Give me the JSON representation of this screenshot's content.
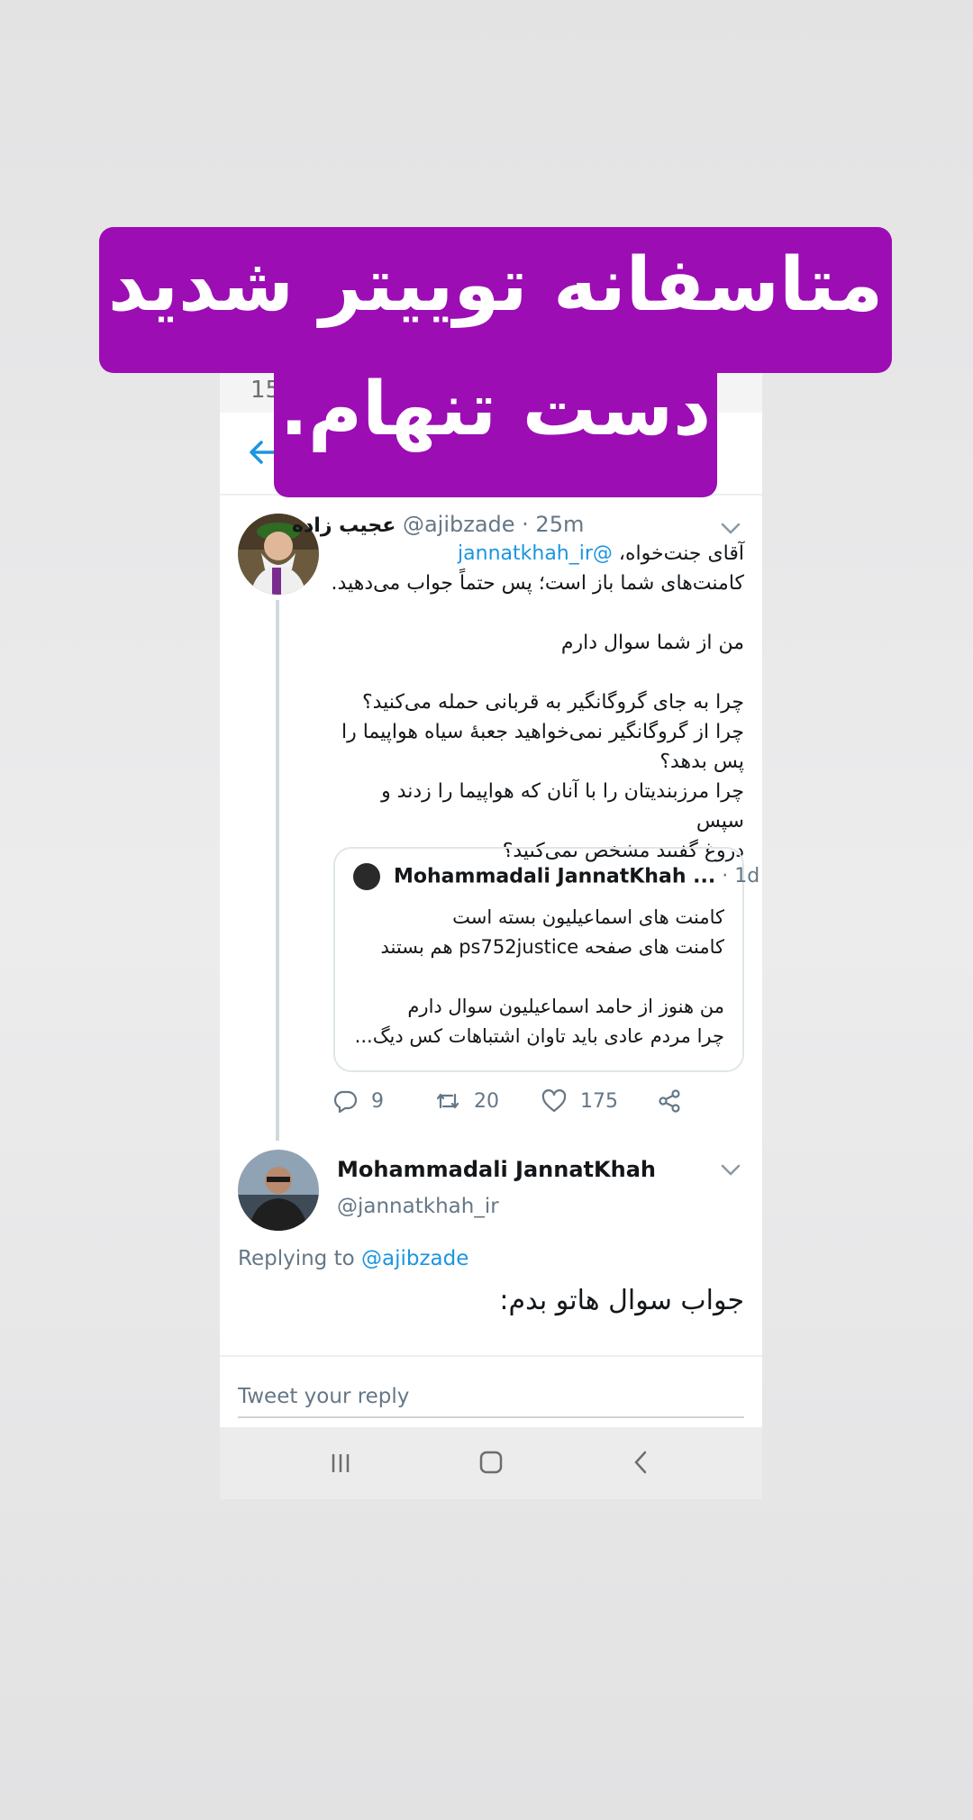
{
  "status": {
    "time_partial": "15"
  },
  "caption": {
    "line1": "متاسفانه توییتر شدید",
    "line2": "دست تنهام."
  },
  "tweet1": {
    "display_name": "عجیب زاده",
    "handle": "@ajibzade",
    "time": "· 25m",
    "lines": [
      {
        "text": "آقای جنت‌خواه، ",
        "mention": "@jannatkhah_ir"
      },
      {
        "text": "کامنت‌های شما باز است؛ پس حتماً جواب می‌دهید."
      },
      {
        "text": ""
      },
      {
        "text": "من از شما سوال دارم"
      },
      {
        "text": ""
      },
      {
        "text": "چرا به جای گروگانگیر به قربانی حمله می‌کنید؟"
      },
      {
        "text": "چرا از گروگانگیر نمی‌خواهید جعبهٔ سیاه هواپیما را"
      },
      {
        "text": "پس بدهد؟"
      },
      {
        "text": "چرا مرزبندیتان را با آنان که هواپیما را زدند و سپس"
      },
      {
        "text": "دروغ گفتند مشخص نمی‌کنید؟"
      }
    ],
    "quote": {
      "name": "Mohammadali JannatKhah ...",
      "time": "· 1d",
      "lines": [
        "کامنت های اسماعیلیون بسته است",
        "کامنت های صفحه ps752justice هم بستند",
        "",
        "من هنوز از حامد اسماعیلیون سوال دارم",
        "چرا مردم عادی باید تاوان اشتباهات کس دیگ..."
      ]
    },
    "actions": {
      "replies": "9",
      "retweets": "20",
      "likes": "175"
    }
  },
  "tweet2": {
    "display_name": "Mohammadali JannatKhah",
    "handle": "@jannatkhah_ir",
    "replying_prefix": "Replying to ",
    "replying_to": "@ajibzade",
    "body": "جواب سوال هاتو بدم:"
  },
  "reply": {
    "placeholder": "Tweet your reply"
  },
  "colors": {
    "accent": "#1b95e0",
    "caption_bg": "#9c0db4",
    "muted": "#657786"
  },
  "icons": [
    "back-arrow-icon",
    "chevron-down-icon",
    "reply-icon",
    "retweet-icon",
    "like-icon",
    "share-icon",
    "nav-recents-icon",
    "nav-home-icon",
    "nav-back-icon"
  ]
}
